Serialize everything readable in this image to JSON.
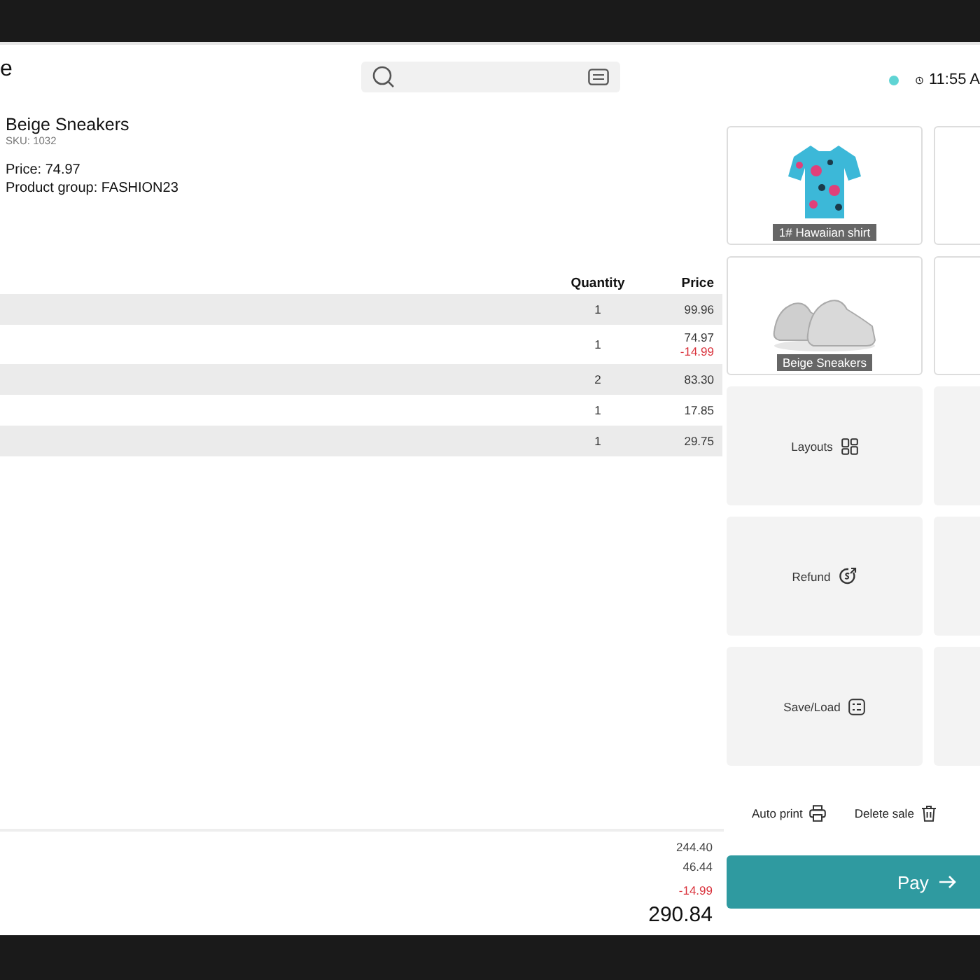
{
  "header": {
    "title": "e",
    "time": "11:55 A"
  },
  "product_detail": {
    "name": "Beige Sneakers",
    "sku": "SKU: 1032",
    "price": "Price: 74.97",
    "group": "Product group: FASHION23"
  },
  "table": {
    "columns": [
      "Quantity",
      "Price"
    ],
    "rows": [
      {
        "quantity": "1",
        "price": "99.96"
      },
      {
        "quantity": "1",
        "price": "74.97",
        "discount": "-14.99"
      },
      {
        "quantity": "2",
        "price": "83.30"
      },
      {
        "quantity": "1",
        "price": "17.85"
      },
      {
        "quantity": "1",
        "price": "29.75"
      }
    ]
  },
  "totals": [
    {
      "value": "244.40",
      "kind": "plain"
    },
    {
      "value": "46.44",
      "kind": "plain"
    },
    {
      "value": "-14.99",
      "kind": "discount"
    },
    {
      "value": "290.84",
      "kind": "total"
    }
  ],
  "tiles": [
    {
      "kind": "shirt",
      "label": "1# Hawaiian shirt"
    },
    {
      "kind": "blank"
    },
    {
      "kind": "sneaker",
      "label": "Beige Sneakers"
    },
    {
      "kind": "blank"
    },
    {
      "kind": "layouts",
      "label": "Layouts"
    },
    {
      "kind": "empty"
    },
    {
      "kind": "refund",
      "label": "Refund"
    },
    {
      "kind": "empty"
    },
    {
      "kind": "save",
      "label": "Save/Load"
    },
    {
      "kind": "empty"
    }
  ],
  "actions": [
    {
      "kind": "print",
      "label": "Auto print"
    },
    {
      "kind": "delete",
      "label": "Delete sale"
    }
  ],
  "pay_button": {
    "label": "Pay"
  }
}
